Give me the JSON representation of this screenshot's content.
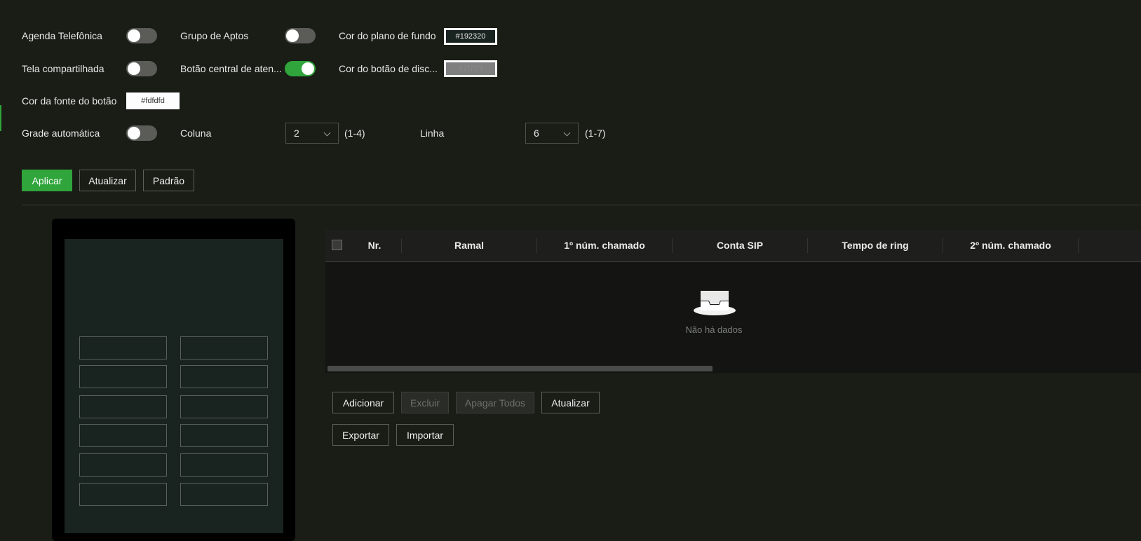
{
  "settings": {
    "agenda_label": "Agenda Telefônica",
    "grupo_label": "Grupo de Aptos",
    "cor_fundo_label": "Cor do plano de fundo",
    "cor_fundo_value": "#192320",
    "tela_label": "Tela compartilhada",
    "botao_central_label": "Botão central de aten...",
    "cor_botao_label": "Cor do botão de disc...",
    "cor_botao_value": "#7f7f7f",
    "cor_fonte_label": "Cor da fonte do botão",
    "cor_fonte_value": "#fdfdfd",
    "grade_label": "Grade automática",
    "coluna_label": "Coluna",
    "coluna_value": "2",
    "coluna_range": "(1-4)",
    "linha_label": "Linha",
    "linha_value": "6",
    "linha_range": "(1-7)",
    "toggles": {
      "agenda": false,
      "grupo": false,
      "tela": false,
      "botao_central": true,
      "grade": false
    }
  },
  "actions": {
    "aplicar": "Aplicar",
    "atualizar": "Atualizar",
    "padrao": "Padrão"
  },
  "table": {
    "columns": [
      "Nr.",
      "Ramal",
      "1º núm. chamado",
      "Conta SIP",
      "Tempo de ring",
      "2º núm. chamado"
    ],
    "empty_text": "Não há dados"
  },
  "table_actions": {
    "adicionar": "Adicionar",
    "excluir": "Excluir",
    "apagar_todos": "Apagar Todos",
    "atualizar": "Atualizar",
    "exportar": "Exportar",
    "importar": "Importar"
  },
  "colors": {
    "accent": "#2fa53b",
    "background": "#1a1c16"
  }
}
